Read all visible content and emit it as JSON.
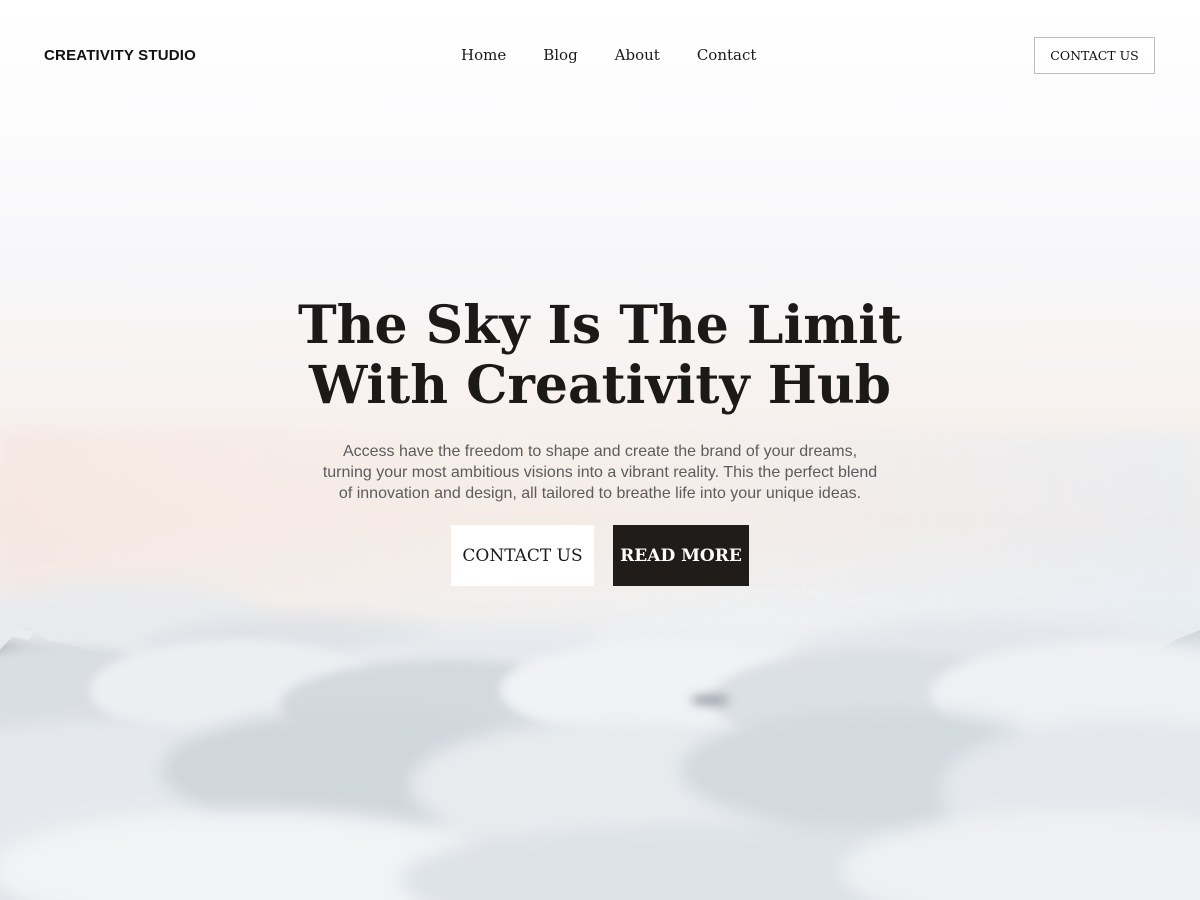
{
  "header": {
    "brand": "CREATIVITY STUDIO",
    "nav": [
      "Home",
      "Blog",
      "About",
      "Contact"
    ],
    "cta_label": "CONTACT US"
  },
  "hero": {
    "title_line1": "The Sky Is The Limit",
    "title_line2": "With Creativity Hub",
    "subtitle_line1": "Access have the freedom to shape and create the brand of your dreams,",
    "subtitle_line2": "turning your most ambitious visions into a vibrant reality. This the perfect blend",
    "subtitle_line3": "of innovation and design, all tailored to breathe life into your unique ideas.",
    "primary_button": "CONTACT US",
    "secondary_button": "READ MORE"
  },
  "colors": {
    "text": "#1b1a18",
    "dark_button": "#201c19",
    "subtitle": "#5c5c5c",
    "border": "#bdbdbd"
  }
}
